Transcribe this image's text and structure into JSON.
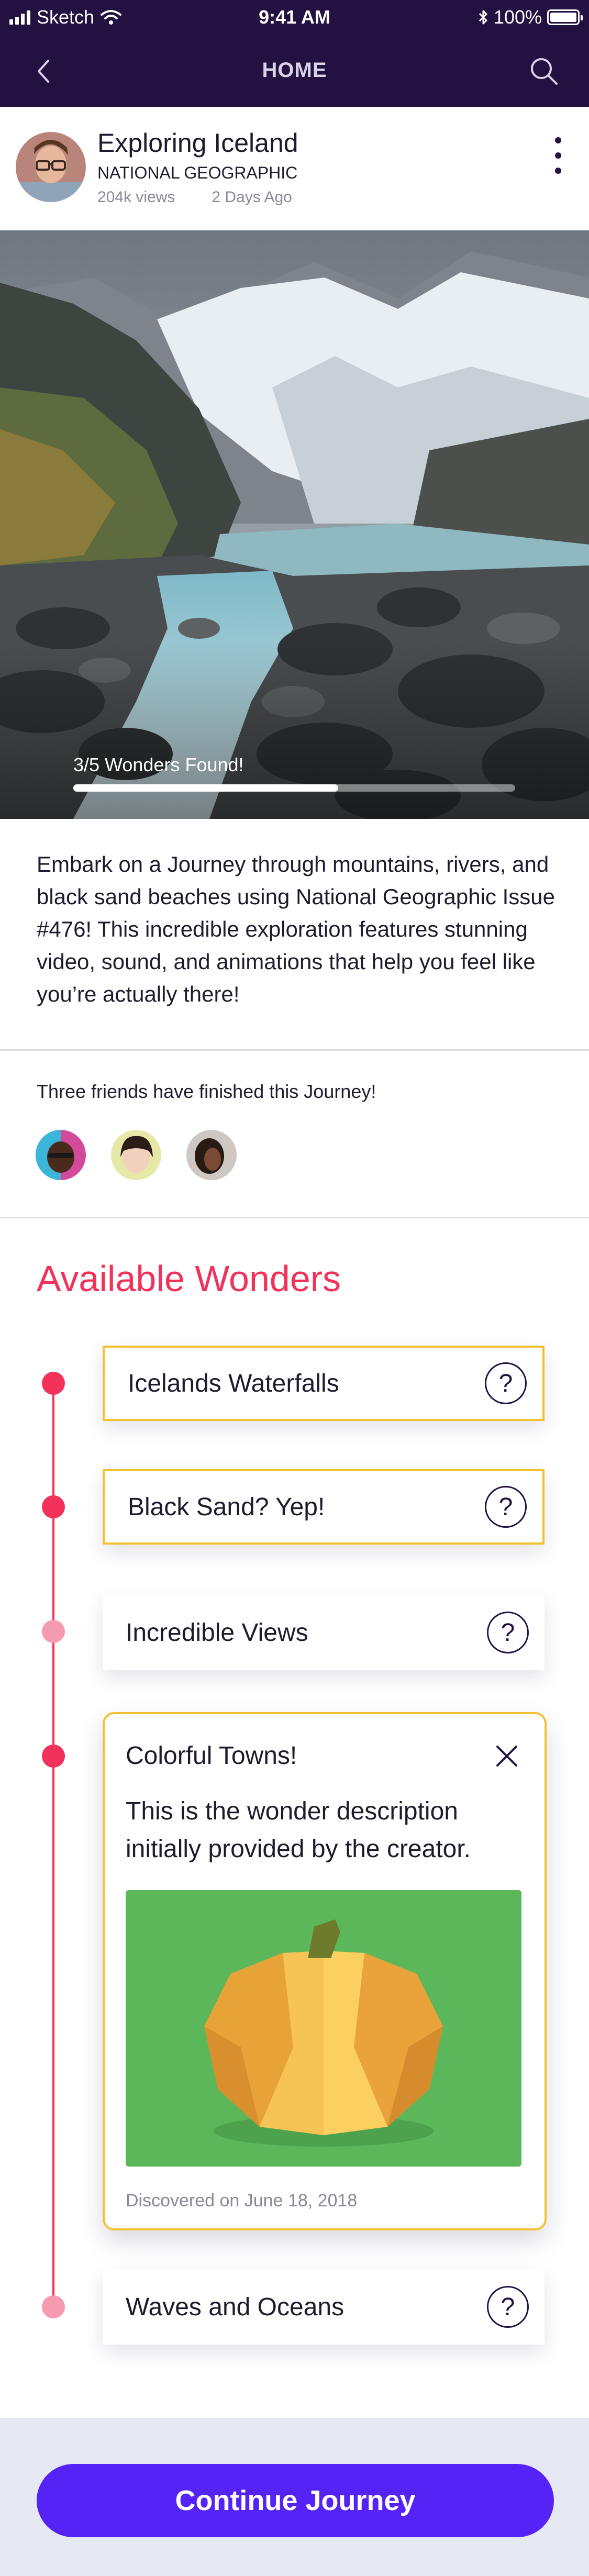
{
  "status_bar": {
    "carrier": "Sketch",
    "time": "9:41 AM",
    "battery": "100%"
  },
  "nav": {
    "title": "HOME",
    "back_icon": "chevron-left-icon",
    "search_icon": "search-icon"
  },
  "post": {
    "title": "Exploring Iceland",
    "publisher": "NATIONAL GEOGRAPHIC",
    "views": "204k views",
    "posted": "2 Days Ago"
  },
  "hero": {
    "progress_label": "3/5 Wonders Found!",
    "progress_fraction": 0.6
  },
  "description": "Embark on a Journey through mountains, rivers, and black sand beaches using National Geographic Issue #476! This incredible exploration features stunning video, sound, and animations that help you feel like you’re actually there!",
  "friends": {
    "label": "Three friends have finished this Journey!"
  },
  "wonders": {
    "title": "Available Wonders",
    "items": [
      {
        "label": "Icelands Waterfalls",
        "found": true
      },
      {
        "label": "Black Sand? Yep!",
        "found": true
      },
      {
        "label": "Incredible Views",
        "found": false
      },
      {
        "label": "Colorful Towns!",
        "found": true
      },
      {
        "label": "Waves and Oceans",
        "found": false
      }
    ],
    "expanded": {
      "title": "Colorful Towns!",
      "description": "This is the wonder description initially provided by the creator.",
      "discovered": "Discovered on June 18, 2018"
    },
    "help_glyph": "?"
  },
  "footer": {
    "cta_label": "Continue Journey"
  },
  "colors": {
    "nav_bg": "#231142",
    "accent": "#f2325a",
    "highlight": "#f2c232",
    "cta": "#5523f5"
  }
}
